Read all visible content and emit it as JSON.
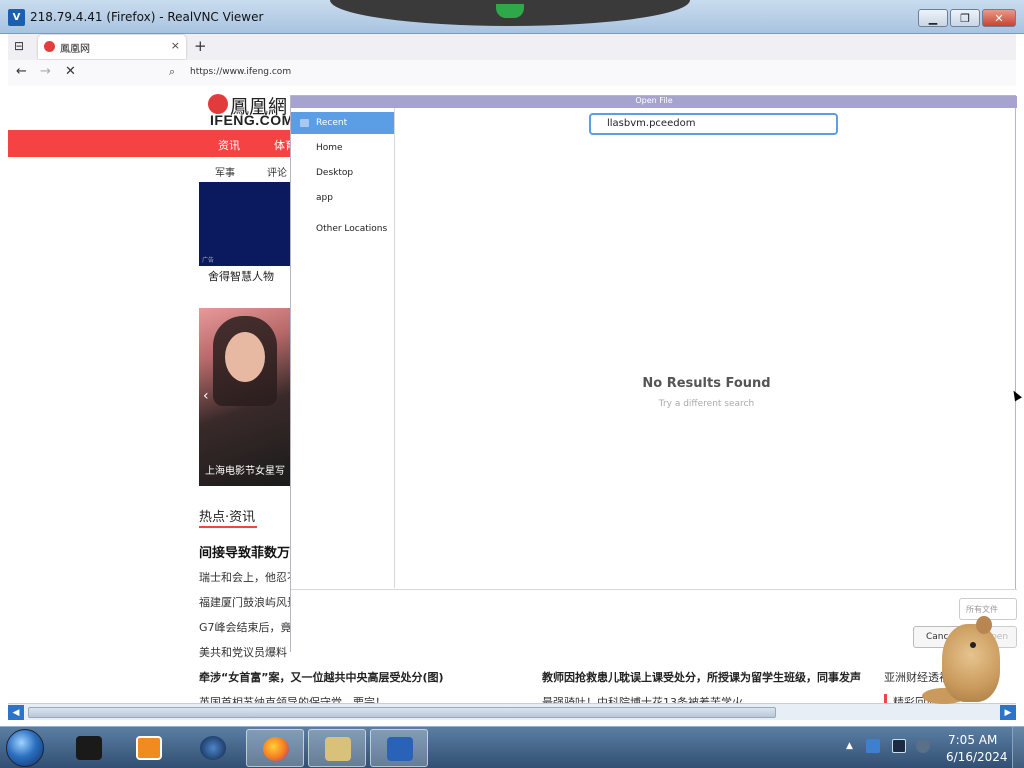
{
  "vnc": {
    "title": "218.79.4.41 (Firefox) - RealVNC Viewer",
    "app_icon": "realvnc-icon",
    "minimize": "▁",
    "maximize": "❐",
    "close": "✕"
  },
  "firefox": {
    "tab_title": "鳳凰网",
    "tab_close": "×",
    "new_tab": "+",
    "url": "https://www.ifeng.com",
    "back": "←",
    "forward": "→",
    "stop": "✕"
  },
  "ifeng": {
    "logo_cn": "鳳凰網",
    "logo_en": "IFENG.COM",
    "red_nav": [
      "资讯",
      "体育"
    ],
    "sub_nav": [
      "军事",
      "评论"
    ],
    "ad_tag": "广告",
    "ad_caption": "舍得智慧人物",
    "photo_caption": "上海电影节女星写",
    "photo_prev": "‹",
    "hot_heading": "热点·资讯",
    "news_headline": "间接导致菲数万",
    "news_lines": [
      "瑞士和会上，他忍不",
      "福建厦门鼓浪屿风景",
      "G7峰会结束后，竟",
      "美共和党议员爆料",
      "牵涉“女首富”案，又一位越共中央高层受处分(图)",
      "英国首相苏纳克领导的保守党，要完！"
    ],
    "news_col2": [
      "教师因抢救患儿耽误上课受处分，所授课为留学生班级，同事发声",
      "最强骑吐！中科院博士花13条被羞苦学火"
    ],
    "news_col3": [
      "亚洲财经透视",
      "精彩回放"
    ]
  },
  "dialog": {
    "title": "Open File",
    "places": [
      {
        "label": "Recent",
        "selected": true
      },
      {
        "label": "Home",
        "selected": false
      },
      {
        "label": "Desktop",
        "selected": false
      },
      {
        "label": "app",
        "selected": false
      },
      {
        "label": "Other Locations",
        "selected": false
      }
    ],
    "search_value": "llasbvm.pceedom",
    "empty_title": "No Results Found",
    "empty_hint": "Try a different search",
    "filter_label": "所有文件",
    "cancel_label": "Cancel",
    "open_label": "Open"
  },
  "taskbar": {
    "time": "7:05 AM",
    "date": "6/16/2024",
    "tray_arrow": "▲",
    "apps": [
      "terminal-icon",
      "media-player-icon",
      "browser-icon",
      "firefox-icon",
      "file-manager-icon",
      "realvnc-icon"
    ],
    "colors": {
      "terminal": "#1a1a1a",
      "media": "#f08b20",
      "browser": "#1b3b6f",
      "firefox": "#f57b20",
      "files": "#d8c27a",
      "realvnc": "#2a62b8"
    }
  },
  "colors": {
    "accent_red": "#f54343",
    "selection_blue": "#5b9ee6"
  }
}
